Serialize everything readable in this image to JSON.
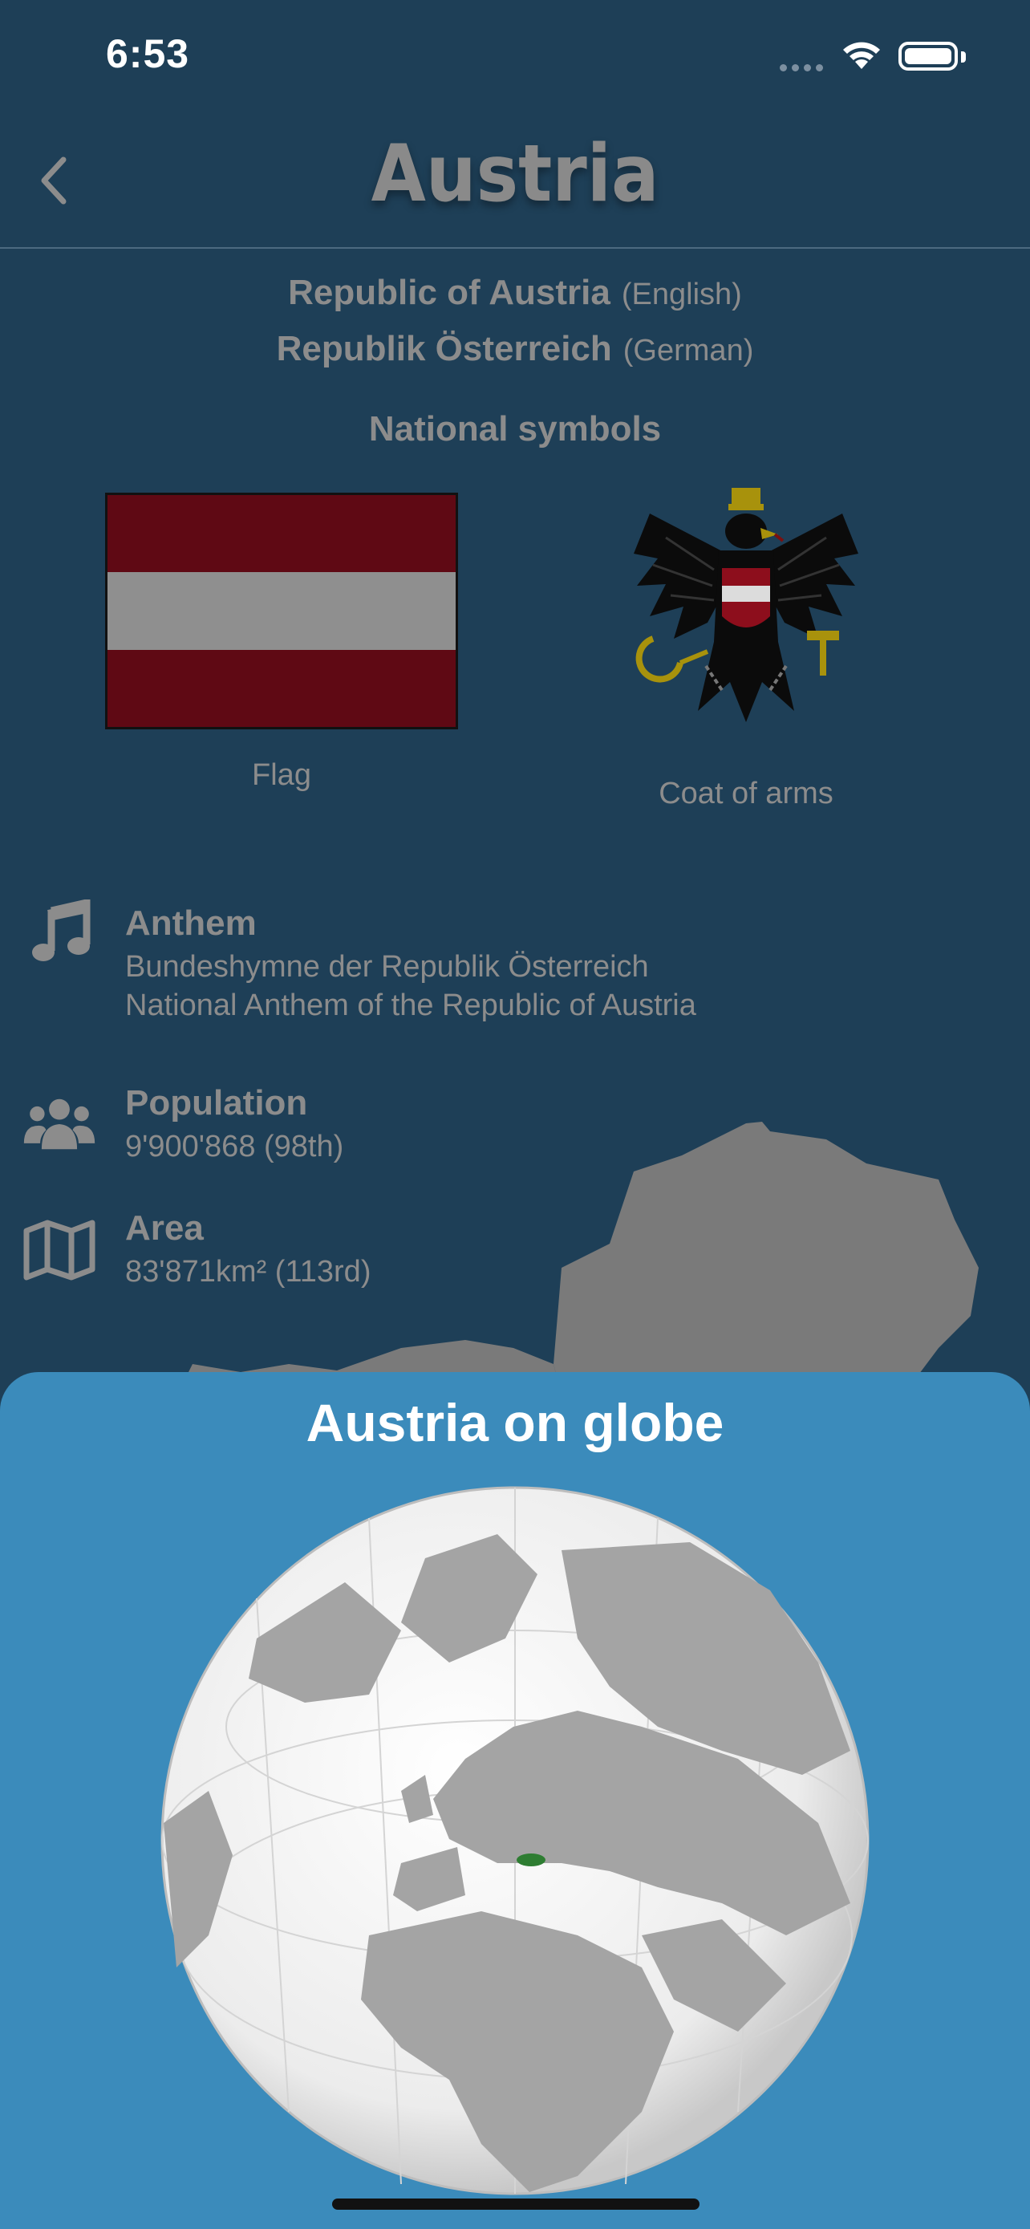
{
  "status_bar": {
    "time": "6:53"
  },
  "header": {
    "title": "Austria"
  },
  "names": [
    {
      "name": "Republic of Austria",
      "language": "(English)"
    },
    {
      "name": "Republik Österreich",
      "language": "(German)"
    }
  ],
  "symbols": {
    "title": "National symbols",
    "flag_label": "Flag",
    "coat_label": "Coat of arms",
    "flag_colors": [
      "#5f0914",
      "#8f8f8f",
      "#5f0914"
    ]
  },
  "anthem": {
    "title": "Anthem",
    "line1": "Bundeshymne der Republik Österreich",
    "line2": "National Anthem of the Republic of Austria",
    "icon": "music-note-icon"
  },
  "population": {
    "title": "Population",
    "value": "9'900'868 (98th)",
    "icon": "people-icon"
  },
  "area": {
    "title": "Area",
    "value": "83'871km² (113rd)",
    "icon": "map-icon"
  },
  "sheet": {
    "title": "Austria on globe"
  },
  "colors": {
    "background": "#1e3f57",
    "sheet": "#3b8bbb",
    "highlight": "#2e7d32"
  }
}
